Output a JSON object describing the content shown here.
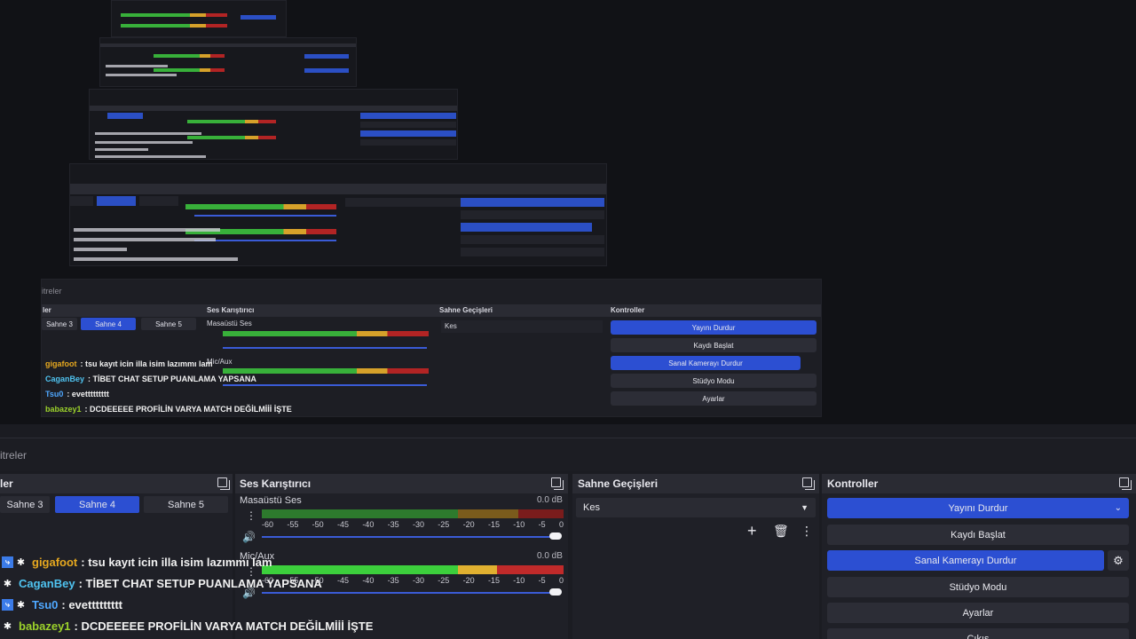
{
  "tabs": {
    "filters_label": "itreler"
  },
  "scenes": {
    "header": "ler",
    "items": [
      "Sahne 3",
      "Sahne 4",
      "Sahne 5"
    ],
    "active_index": 1
  },
  "mixer": {
    "header": "Ses Karıştırıcı",
    "channels": [
      {
        "name": "Masaüstü Ses",
        "db": "0.0 dB",
        "level": 0.55
      },
      {
        "name": "Mic/Aux",
        "db": "0.0 dB",
        "level": 0.58
      }
    ],
    "ticks": [
      "-60",
      "-55",
      "-50",
      "-45",
      "-40",
      "-35",
      "-30",
      "-25",
      "-20",
      "-15",
      "-10",
      "-5",
      "0"
    ]
  },
  "transitions": {
    "header": "Sahne Geçişleri",
    "selected": "Kes"
  },
  "controls": {
    "header": "Kontroller",
    "stop_stream": "Yayını Durdur",
    "start_record": "Kaydı Başlat",
    "stop_virtual_cam": "Sanal Kamerayı Durdur",
    "studio_mode": "Stüdyo Modu",
    "settings": "Ayarlar",
    "exit": "Çıkış"
  },
  "chat": [
    {
      "user": "gigafoot",
      "message": ": tsu kayıt icin illa isim lazımmı lam",
      "color": "#e6a81f",
      "icon": "twitch"
    },
    {
      "user": "CaganBey",
      "message": ": TİBET CHAT SETUP PUANLAMA YAPSANA",
      "color": "#4fc3f0",
      "icon": "star"
    },
    {
      "user": "Tsu0",
      "message": ": evettttttttt",
      "color": "#4fa8ff",
      "icon": "twitch"
    },
    {
      "user": "babazey1",
      "message": ": DCDEEEEE PROFİLİN VARYA MATCH DEĞİLMİİİ İŞTE",
      "color": "#9cd22b",
      "icon": "star"
    }
  ],
  "colors": {
    "accent": "#2c4fd2",
    "meter_green": "#3ccf3c",
    "meter_yellow": "#e0b030",
    "meter_red": "#c02a2a"
  }
}
